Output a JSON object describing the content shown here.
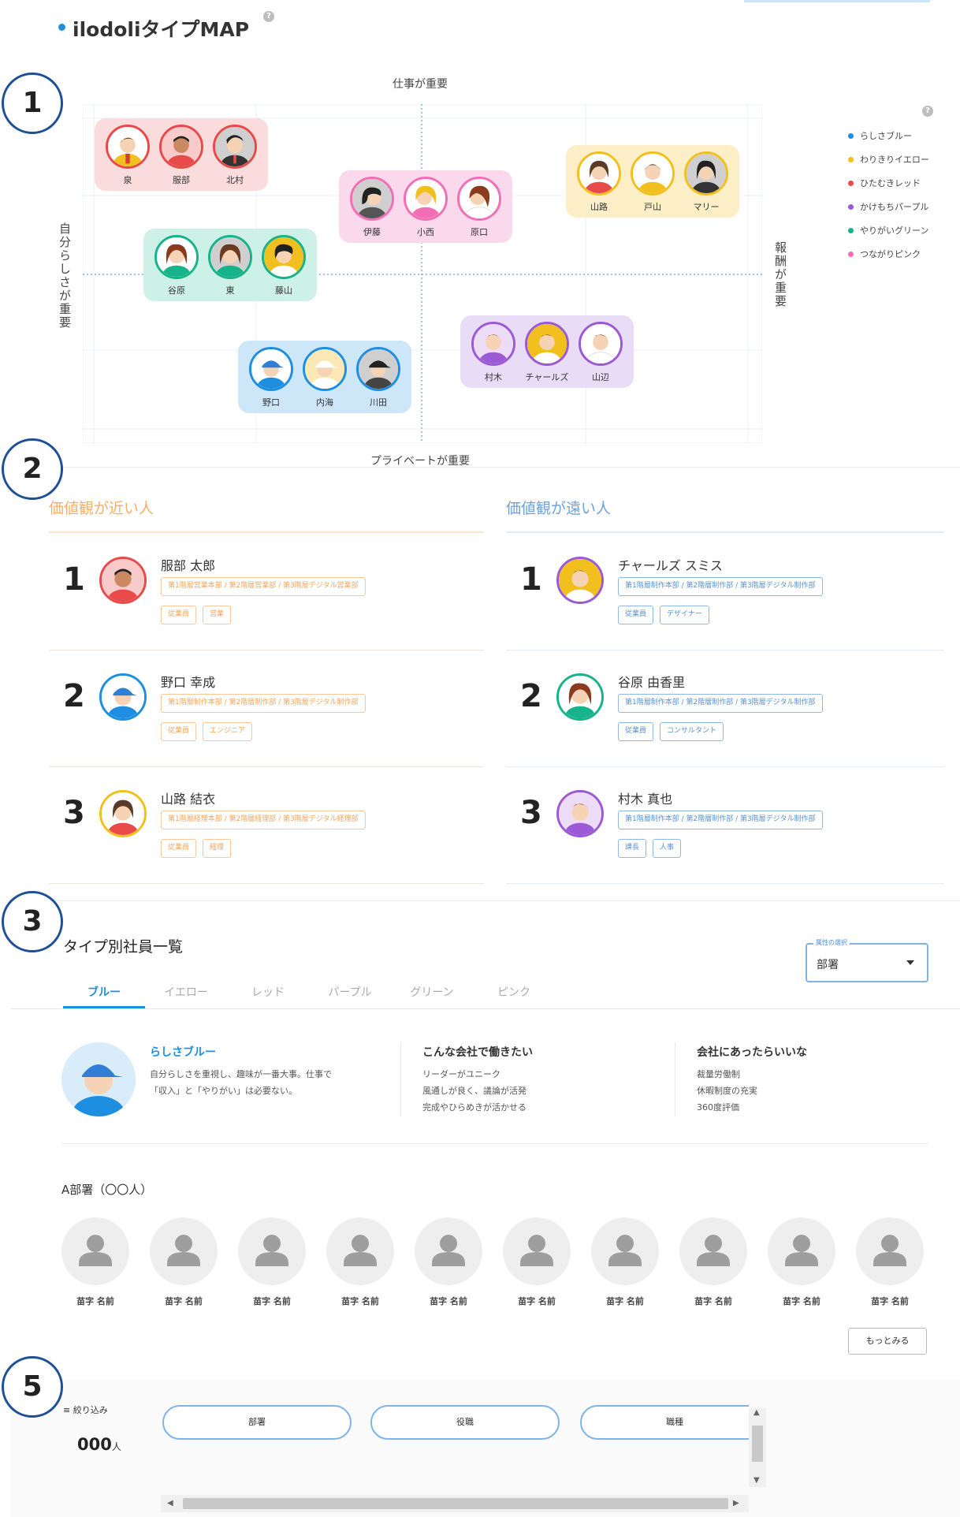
{
  "header": {
    "title": "ilodoliタイプMAP"
  },
  "markers": [
    "1",
    "2",
    "3",
    "5"
  ],
  "map": {
    "axes": {
      "top": "仕事が重要",
      "bottom": "プライベートが重要",
      "left": "自分らしさが重要",
      "right": "報酬が重要"
    },
    "legend": [
      {
        "label": "らしさブルー",
        "color": "#1e8fe0"
      },
      {
        "label": "わりきりイエロー",
        "color": "#f2c01e"
      },
      {
        "label": "ひたむきレッド",
        "color": "#e84a4a"
      },
      {
        "label": "かけもちパープル",
        "color": "#9b59d6"
      },
      {
        "label": "やりがいグリーン",
        "color": "#17b38a"
      },
      {
        "label": "つながりピンク",
        "color": "#f26fb6"
      }
    ],
    "groups": [
      {
        "type": "red",
        "members": [
          "泉",
          "服部",
          "北村"
        ]
      },
      {
        "type": "pink",
        "members": [
          "伊藤",
          "小西",
          "原口"
        ]
      },
      {
        "type": "yellow",
        "members": [
          "山路",
          "戸山",
          "マリー"
        ]
      },
      {
        "type": "green",
        "members": [
          "谷原",
          "東",
          "藤山"
        ]
      },
      {
        "type": "purple",
        "members": [
          "村木",
          "チャールズ",
          "山辺"
        ]
      },
      {
        "type": "blue",
        "members": [
          "野口",
          "内海",
          "川田"
        ]
      }
    ]
  },
  "ranking": {
    "near": {
      "heading": "価値観が近い人",
      "rows": [
        {
          "rank": "1",
          "name": "服部 太郎",
          "path": "第1階層営業本部 / 第2階層営業部 / 第3階層デジタル営業部",
          "tags": [
            "従業員",
            "営業"
          ]
        },
        {
          "rank": "2",
          "name": "野口 幸成",
          "path": "第1階層制作本部 / 第2階層制作部 / 第3階層デジタル制作部",
          "tags": [
            "従業員",
            "エンジニア"
          ]
        },
        {
          "rank": "3",
          "name": "山路 結衣",
          "path": "第1階層経理本部 / 第2階層経理部 / 第3階層デジタル経理部",
          "tags": [
            "従業員",
            "経理"
          ]
        }
      ]
    },
    "far": {
      "heading": "価値観が遠い人",
      "rows": [
        {
          "rank": "1",
          "name": "チャールズ スミス",
          "path": "第1階層制作本部 / 第2階層制作部 / 第3階層デジタル制作部",
          "tags": [
            "従業員",
            "デザイナー"
          ]
        },
        {
          "rank": "2",
          "name": "谷原 由香里",
          "path": "第1階層制作本部 / 第2階層制作部 / 第3階層デジタル制作部",
          "tags": [
            "従業員",
            "コンサルタント"
          ]
        },
        {
          "rank": "3",
          "name": "村木 真也",
          "path": "第1階層制作本部 / 第2階層制作部 / 第3階層デジタル制作部",
          "tags": [
            "課長",
            "人事"
          ]
        }
      ]
    }
  },
  "typeList": {
    "title": "タイプ別社員一覧",
    "select": {
      "legend": "属性の選択",
      "value": "部署"
    },
    "tabs": [
      "ブルー",
      "イエロー",
      "レッド",
      "パープル",
      "グリーン",
      "ピンク"
    ],
    "activeTab": 0,
    "profile": {
      "name": "らしさブルー",
      "description": [
        "自分らしさを重視し、趣味が一番大事。仕事で",
        "「収入」と「やりがい」は必要ない。"
      ]
    },
    "wantCompany": {
      "title": "こんな会社で働きたい",
      "items": [
        "リーダーがユニーク",
        "風通しが良く、議論が活発",
        "完成やひらめきが活かせる"
      ]
    },
    "wantSystem": {
      "title": "会社にあったらいいな",
      "items": [
        "裁量労働制",
        "休暇制度の充実",
        "360度評価"
      ]
    },
    "department": "A部署（〇〇人）",
    "employees": [
      "苗字 名前",
      "苗字 名前",
      "苗字 名前",
      "苗字 名前",
      "苗字 名前",
      "苗字 名前",
      "苗字 名前",
      "苗字 名前",
      "苗字 名前",
      "苗字 名前"
    ],
    "moreLabel": "もっとみる"
  },
  "filter": {
    "label": "絞り込み",
    "count": "000",
    "unit": "人",
    "pills": [
      "部署",
      "役職",
      "職種"
    ]
  },
  "colors": {
    "accent": "#1e8fe0",
    "nearHeading": "#f5b06b",
    "farHeading": "#6fa3d6"
  }
}
